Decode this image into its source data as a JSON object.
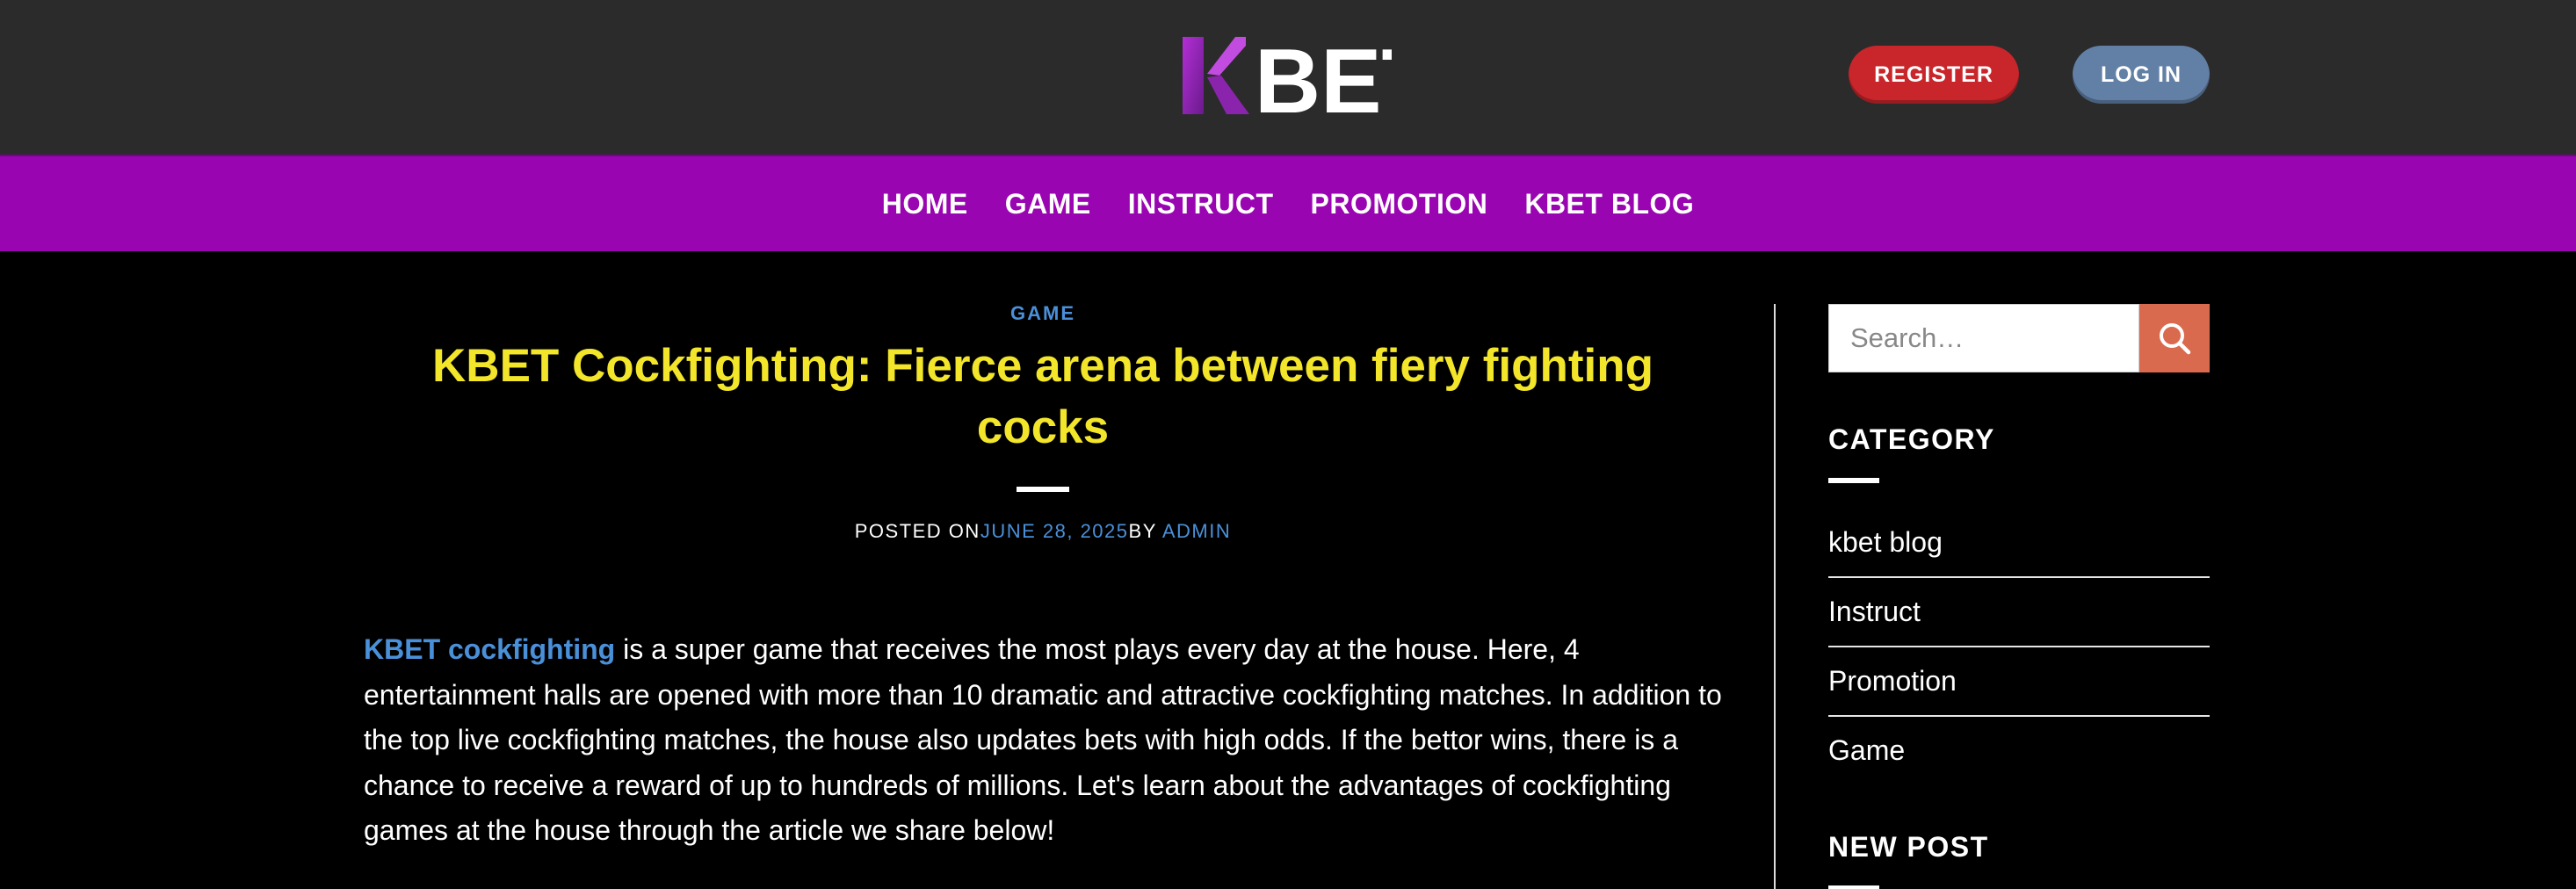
{
  "header": {
    "logo_text": "KBET",
    "register_label": "REGISTER",
    "login_label": "LOG IN"
  },
  "nav": {
    "items": [
      "HOME",
      "GAME",
      "INSTRUCT",
      "PROMOTION",
      "KBET BLOG"
    ]
  },
  "article": {
    "category": "GAME",
    "title": "KBET Cockfighting: Fierce arena between fiery fighting cocks",
    "meta": {
      "posted_on_label": "POSTED ON",
      "date": "JUNE 28, 2025",
      "by_label": "BY",
      "author": "ADMIN"
    },
    "intro_link": "KBET cockfighting",
    "intro_text": " is a super game that receives the most plays every day at the house. Here, 4 entertainment halls are opened with more than 10 dramatic and attractive cockfighting matches. In addition to the top live cockfighting matches, the house also updates bets with high odds. If the bettor wins, there is a chance to receive a reward of up to hundreds of millions. Let's learn about the advantages of cockfighting games at the house through the article we share below!"
  },
  "sidebar": {
    "search_placeholder": "Search…",
    "category_title": "CATEGORY",
    "categories": [
      "kbet blog",
      "Instruct",
      "Promotion",
      "Game"
    ],
    "new_post_title": "NEW POST"
  },
  "colors": {
    "header_bg": "#2b2b2b",
    "nav_bg": "#9a05b2",
    "title_yellow": "#f2e52a",
    "link_blue": "#4a90d9",
    "register_red": "#c8262b",
    "login_blue": "#6280a6",
    "search_btn": "#d96a4e"
  }
}
